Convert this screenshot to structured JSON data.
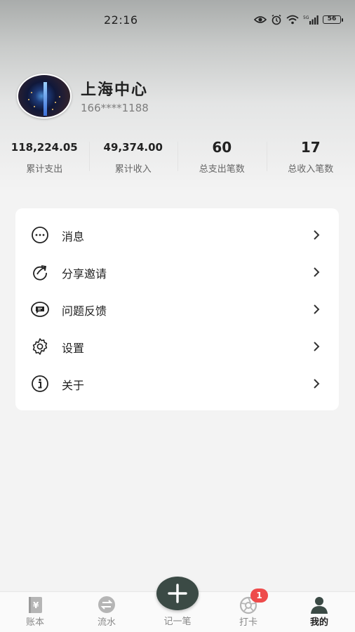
{
  "status_bar": {
    "time": "22:16",
    "battery": "56"
  },
  "profile": {
    "name": "上海中心",
    "phone": "166****1188"
  },
  "stats": [
    {
      "value": "118,224.05",
      "label": "累计支出"
    },
    {
      "value": "49,374.00",
      "label": "累计收入"
    },
    {
      "value": "60",
      "label": "总支出笔数"
    },
    {
      "value": "17",
      "label": "总收入笔数"
    }
  ],
  "menu": [
    {
      "label": "消息",
      "icon": "message-dots-icon"
    },
    {
      "label": "分享邀请",
      "icon": "share-icon"
    },
    {
      "label": "问题反馈",
      "icon": "feedback-icon"
    },
    {
      "label": "设置",
      "icon": "gear-icon"
    },
    {
      "label": "关于",
      "icon": "info-icon"
    }
  ],
  "nav": [
    {
      "label": "账本",
      "icon": "ledger-icon"
    },
    {
      "label": "流水",
      "icon": "transfer-icon"
    },
    {
      "label": "记一笔",
      "icon": "plus-icon"
    },
    {
      "label": "打卡",
      "icon": "camera-aperture-icon",
      "badge": "1"
    },
    {
      "label": "我的",
      "icon": "user-icon",
      "active": true
    }
  ],
  "colors": {
    "accent": "#3b4a45",
    "badge": "#ee4b4b"
  }
}
